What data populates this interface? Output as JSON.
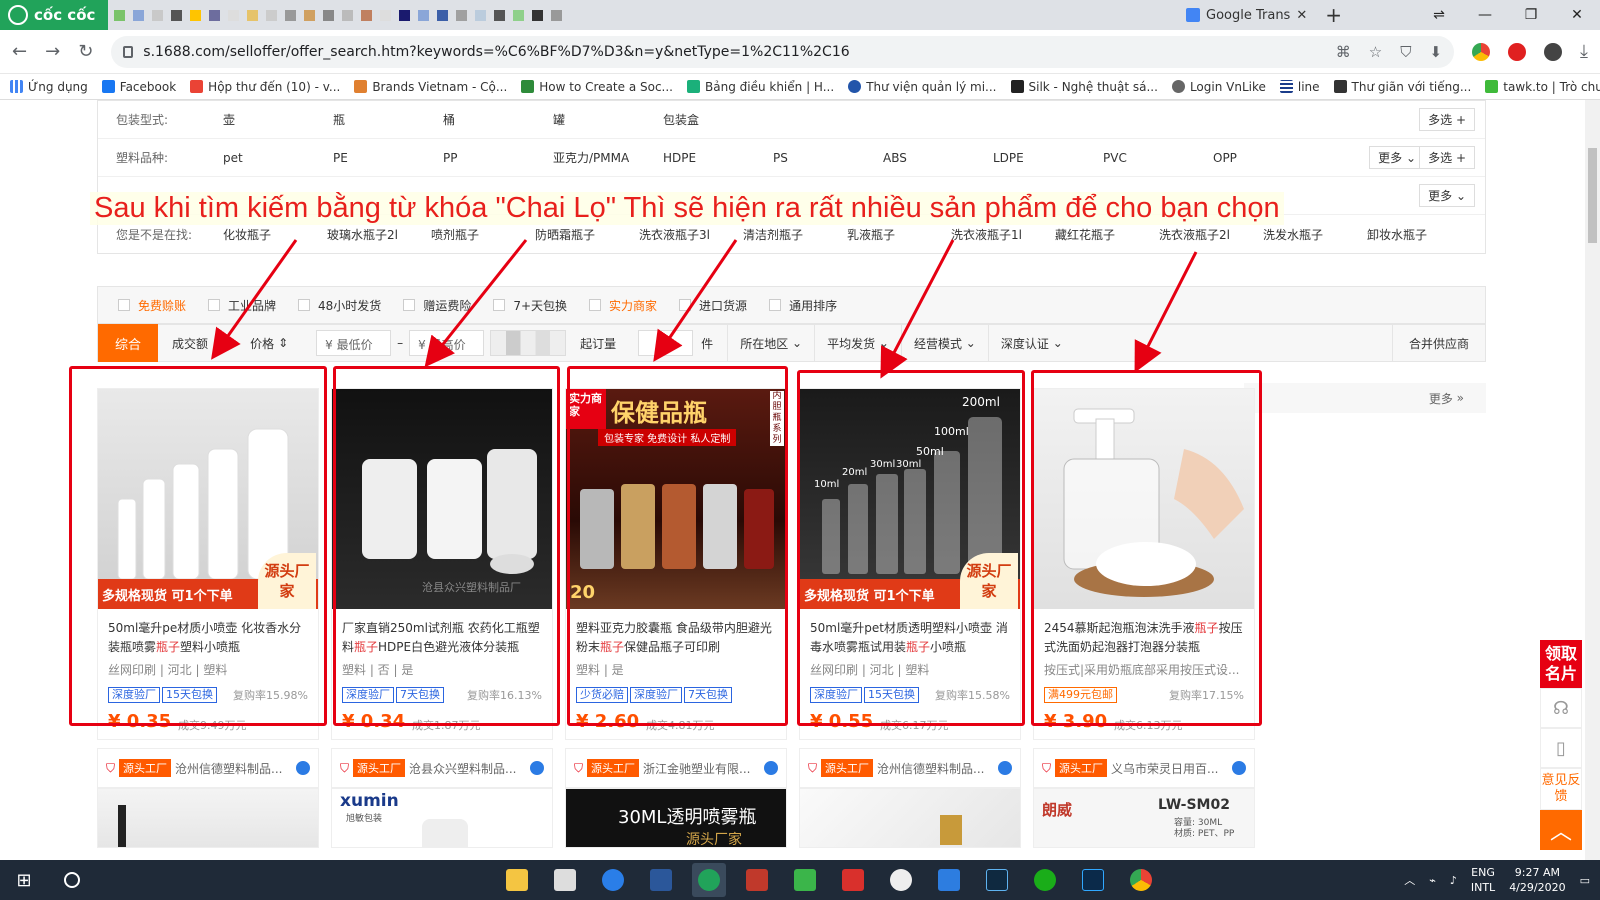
{
  "browser": {
    "brand": "cốc cốc",
    "active_tab_title": "Google Trans",
    "url": "s.1688.com/selloffer/offer_search.htm?keywords=%C6%BF%D7%D3&n=y&netType=1%2C11%2C16",
    "bookmarks": [
      {
        "label": "Ứng dụng",
        "icon": "apps-icon"
      },
      {
        "label": "Facebook",
        "icon": "facebook-icon"
      },
      {
        "label": "Hộp thư đến (10) - v...",
        "icon": "gmail-icon"
      },
      {
        "label": "Brands Vietnam - Cộ...",
        "icon": "brands-icon"
      },
      {
        "label": "How to Create a Soc...",
        "icon": "doc-icon"
      },
      {
        "label": "Bảng điều khiển | H...",
        "icon": "shield-icon"
      },
      {
        "label": "Thư viện quản lý mi...",
        "icon": "library-icon"
      },
      {
        "label": "Silk - Nghệ thuật sá...",
        "icon": "silk-icon"
      },
      {
        "label": "Login VnLike",
        "icon": "globe-icon"
      },
      {
        "label": "line",
        "icon": "grid-icon"
      },
      {
        "label": "Thư giãn với tiếng...",
        "icon": "bird-icon"
      },
      {
        "label": "tawk.to | Trò chuyện",
        "icon": "tawk-icon"
      }
    ]
  },
  "filters": {
    "rows": [
      {
        "label": "包装型式:",
        "options": [
          "壶",
          "瓶",
          "桶",
          "罐",
          "包装盒"
        ],
        "more": "",
        "multi": "多选"
      },
      {
        "label": "塑料品种:",
        "options": [
          "pet",
          "PE",
          "PP",
          "亚克力/PMMA",
          "HDPE",
          "PS",
          "ABS",
          "LDPE",
          "PVC",
          "OPP"
        ],
        "more": "更多",
        "multi": "多选"
      },
      {
        "label": "",
        "options": [],
        "more": "更多",
        "multi": ""
      },
      {
        "label": "您是不是在找:",
        "options": [
          "化妆瓶子",
          "玻璃水瓶子2l",
          "喷剂瓶子",
          "防晒霜瓶子",
          "洗衣液瓶子3l",
          "清洁剂瓶子",
          "乳液瓶子",
          "洗衣液瓶子1l",
          "藏红花瓶子",
          "洗衣液瓶子2l",
          "洗发水瓶子",
          "卸妆水瓶子"
        ],
        "more": "",
        "multi": ""
      }
    ]
  },
  "banner_text": "Sau khi tìm kiếm bằng từ khóa \"Chai Lọ\" Thì sẽ hiện ra rất nhiều sản phẩm để cho bạn chọn",
  "checkboxes": [
    "免费赊账",
    "工业品牌",
    "48小时发货",
    "赠运费险",
    "7+天包换",
    "实力商家",
    "进口货源",
    "通用排序"
  ],
  "sort": {
    "active": "综合",
    "items": [
      "成交额",
      "价格"
    ],
    "min_price": "¥ 最低价",
    "max_price": "¥ 最高价",
    "moq_label": "起订量",
    "moq_suffix": "件",
    "dropdowns": [
      "所在地区",
      "平均发货",
      "经营模式",
      "深度认证"
    ],
    "merge": "合并供应商"
  },
  "related_more": "更多",
  "products": [
    {
      "title_pre": "50ml毫升pe材质小喷壶 化妆香水分装瓶喷雾",
      "title_hl": "瓶子",
      "title_post": "塑料小喷瓶",
      "attrs": "丝网印刷 | 河北 | 塑料",
      "tags": [
        "深度验厂",
        "15天包换"
      ],
      "rate": "复购率15.98%",
      "price": "¥ 0.35",
      "deal": "成交9.49万元",
      "seller_badge": "源头工厂",
      "seller": "沧州信德塑料制品..."
    },
    {
      "title_pre": "厂家直销250ml试剂瓶 农药化工瓶塑料",
      "title_hl": "瓶子",
      "title_post": "HDPE白色避光液体分装瓶",
      "attrs": "塑料 | 否 | 是",
      "tags": [
        "深度验厂",
        "7天包换"
      ],
      "rate": "复购率16.13%",
      "price": "¥ 0.34",
      "deal": "成交1.87万元",
      "seller_badge": "源头工厂",
      "seller": "沧县众兴塑料制品..."
    },
    {
      "title_pre": "塑料亚克力胶囊瓶 食品级带内胆避光粉末",
      "title_hl": "瓶子",
      "title_post": "保健品瓶子可印刷",
      "attrs": "塑料 | 是",
      "tags": [
        "少货必赔",
        "深度验厂",
        "7天包换"
      ],
      "rate": "",
      "price": "¥ 2.60",
      "deal": "成交4.81万元",
      "seller_badge": "源头工厂",
      "seller": "浙江金驰塑业有限..."
    },
    {
      "title_pre": "50ml毫升pet材质透明塑料小喷壶 消毒水喷雾瓶试用装",
      "title_hl": "瓶子",
      "title_post": "小喷瓶",
      "attrs": "丝网印刷 | 河北 | 塑料",
      "tags": [
        "深度验厂",
        "15天包换"
      ],
      "rate": "复购率15.58%",
      "price": "¥ 0.55",
      "deal": "成交6.17万元",
      "seller_badge": "源头工厂",
      "seller": "沧州信德塑料制品..."
    },
    {
      "title_pre": "2454慕斯起泡瓶泡沫洗手液",
      "title_hl": "瓶子",
      "title_post": "按压式洗面奶起泡器打泡器分装瓶",
      "attrs": "按压式|采用奶瓶底部采用按压式设...",
      "tags": [
        "满499元包邮"
      ],
      "rate": "复购率17.15%",
      "price": "¥ 3.90",
      "deal": "成交6.13万元",
      "seller_badge": "源头工厂",
      "seller": "义乌市荣灵日用百..."
    }
  ],
  "product_image_text": {
    "badge_left": "多规格现货 可1个下单",
    "badge_right": "源头厂家",
    "p2_watermark": "沧县众兴塑料制品厂",
    "p3_top": "保健品瓶",
    "p3_sub": "包装专家 免费设计 私人定制",
    "p3_corner": "实力商家",
    "p3_side": "内胆瓶系列",
    "p3_num": "20",
    "p4_sizes": [
      "200ml",
      "100ml",
      "50ml",
      "30ml",
      "30ml",
      "20ml",
      "10ml"
    ]
  },
  "next_row": {
    "card2_brand": "xumin",
    "card2_sub": "旭敏包装",
    "card3_text": "30ML透明喷雾瓶",
    "card3_sub": "源头厂家",
    "card5_brand": "朗威",
    "card5_model": "LW-SM02",
    "card5_spec1": "容量: 30ML",
    "card5_spec2": "材质: PET、PP"
  },
  "side_float": {
    "card": "领取名片",
    "feedback": "意见反馈"
  },
  "taskbar": {
    "lang1": "ENG",
    "lang2": "INTL",
    "time": "9:27 AM",
    "date": "4/29/2020"
  },
  "colors": {
    "accent": "#ff6a00",
    "annotation": "#e60012",
    "price": "#ff5000"
  }
}
